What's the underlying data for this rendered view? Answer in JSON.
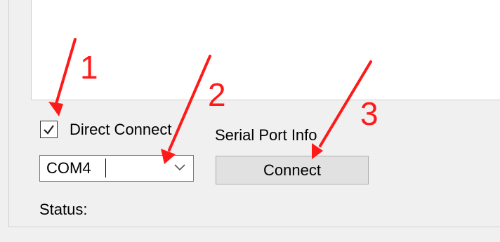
{
  "serial_panel": {
    "checkbox": {
      "label": "Direct Connect",
      "checked": true
    },
    "serial_port_info_label": "Serial Port Info",
    "port_select": {
      "value": "COM4"
    },
    "connect_button": "Connect",
    "status_label": "Status:"
  },
  "annotations": {
    "step1": "1",
    "step2": "2",
    "step3": "3",
    "color": "#ff1a1a"
  }
}
